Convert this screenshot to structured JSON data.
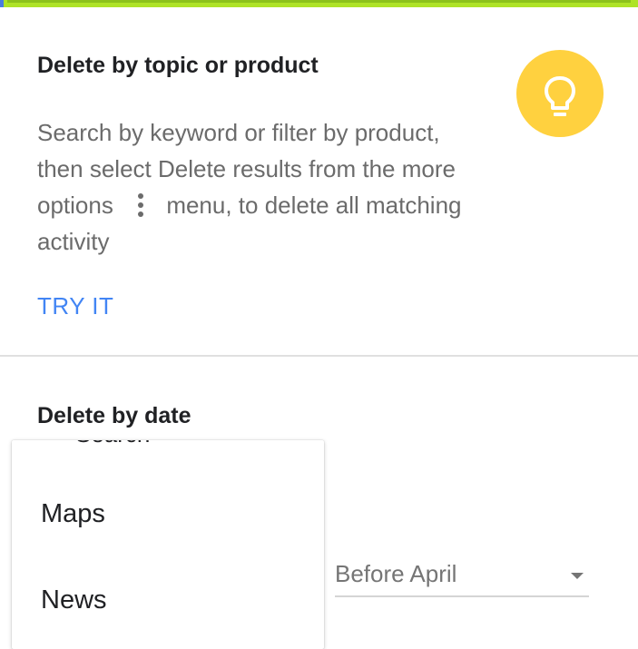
{
  "colors": {
    "top_strip": "#aee327",
    "accent_link": "#4285f4",
    "bulb_circle": "#ffd13f"
  },
  "topic_card": {
    "title": "Delete by topic or product",
    "desc_part1": "Search by keyword or filter by product, then select Delete results from the more options",
    "desc_part2": "menu, to delete all matching activity",
    "more_icon": "more-vert-icon",
    "bulb_icon": "lightbulb-icon",
    "action_label": "TRY IT"
  },
  "date_card": {
    "title": "Delete by date",
    "select_value": "Before April"
  },
  "dropdown": {
    "clipped_item": "Search",
    "items": [
      {
        "label": "Maps"
      },
      {
        "label": "News"
      }
    ]
  }
}
